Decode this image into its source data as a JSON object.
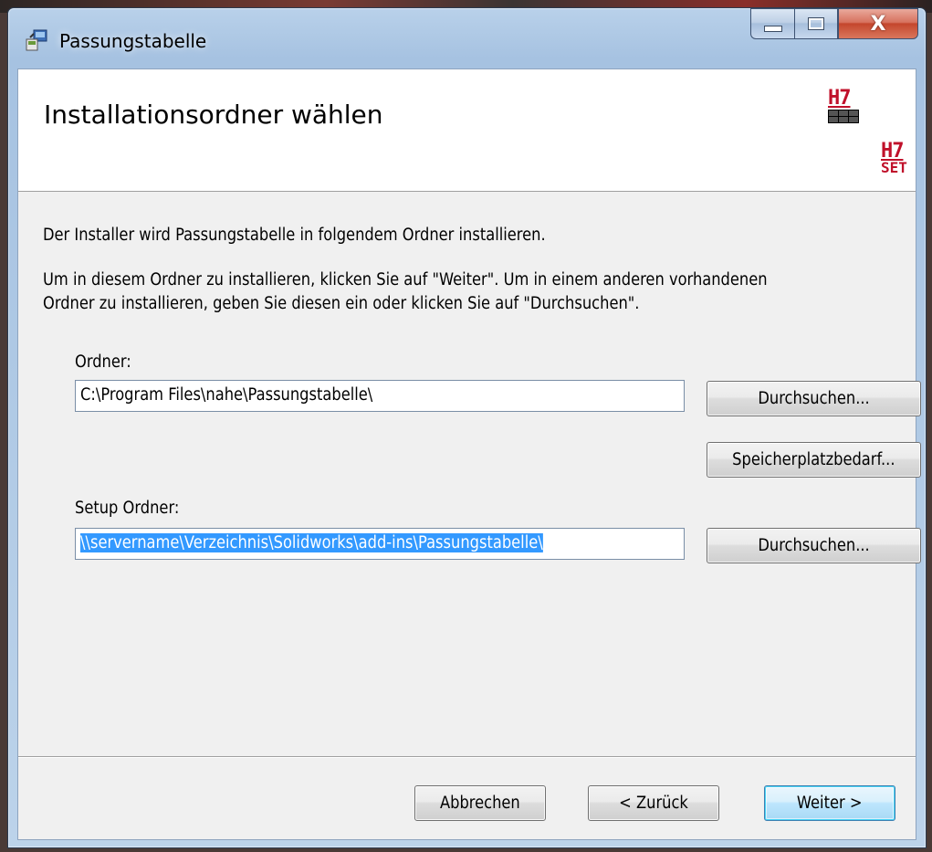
{
  "window": {
    "title": "Passungstabelle",
    "close_glyph": "X",
    "icon": "installer-icon"
  },
  "banner": {
    "heading": "Installationsordner wählen",
    "logo_top": {
      "text": "H7",
      "icon": "table-grid-icon"
    },
    "logo_bottom": {
      "text_top": "H7",
      "text_bottom": "SET"
    }
  },
  "body": {
    "intro": "Der Installer wird Passungstabelle in folgendem Ordner installieren.",
    "instruction_line1": "Um in diesem Ordner zu installieren, klicken Sie auf \"Weiter\". Um in einem anderen vorhandenen",
    "instruction_line2": "Ordner zu installieren, geben Sie diesen ein oder klicken Sie auf \"Durchsuchen\"."
  },
  "folder": {
    "label": "Ordner:",
    "value": "C:\\Program Files\\nahe\\Passungstabelle\\",
    "browse_label": "Durchsuchen...",
    "disk_cost_label": "Speicherplatzbedarf..."
  },
  "setup_folder": {
    "label": "Setup Ordner:",
    "value": "\\\\servername\\Verzeichnis\\Solidworks\\add-ins\\Passungstabelle\\",
    "browse_label": "Durchsuchen..."
  },
  "footer": {
    "cancel_label": "Abbrechen",
    "back_label": "< Zurück",
    "next_label": "Weiter >"
  }
}
